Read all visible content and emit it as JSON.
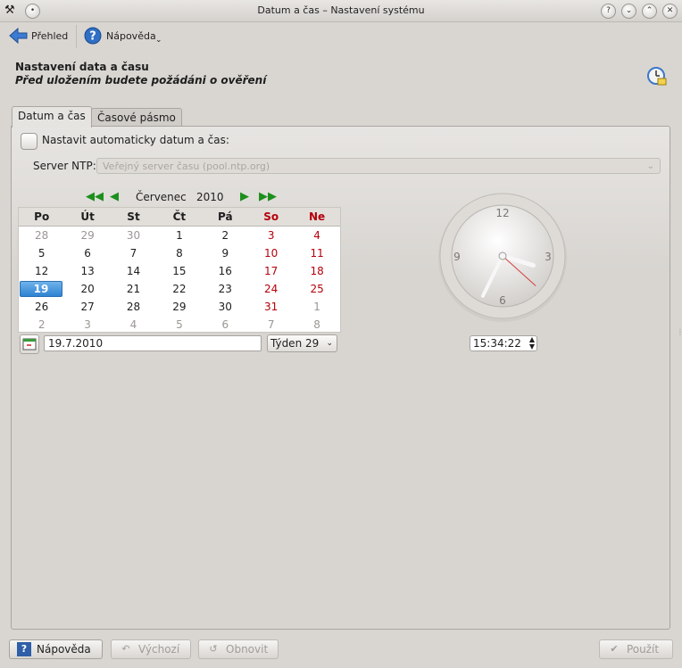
{
  "window": {
    "title": "Datum a čas – Nastavení systému"
  },
  "toolbar": {
    "back_label": "Přehled",
    "help_label": "Nápověda"
  },
  "header": {
    "title": "Nastavení data a času",
    "subtitle": "Před uložením budete požádáni o ověření"
  },
  "tabs": [
    {
      "label": "Datum a čas",
      "active": true
    },
    {
      "label": "Časové pásmo",
      "active": false
    }
  ],
  "auto": {
    "label": "Nastavit automaticky datum a čas:",
    "checked": false
  },
  "ntp": {
    "label": "Server NTP:",
    "value": "Veřejný server času (pool.ntp.org)"
  },
  "calendar": {
    "month": "Červenec",
    "year": "2010",
    "weekdays": [
      "Po",
      "Út",
      "St",
      "Čt",
      "Pá",
      "So",
      "Ne"
    ],
    "weeks": [
      [
        "28",
        "29",
        "30",
        "1",
        "2",
        "3",
        "4"
      ],
      [
        "5",
        "6",
        "7",
        "8",
        "9",
        "10",
        "11"
      ],
      [
        "12",
        "13",
        "14",
        "15",
        "16",
        "17",
        "18"
      ],
      [
        "19",
        "20",
        "21",
        "22",
        "23",
        "24",
        "25"
      ],
      [
        "26",
        "27",
        "28",
        "29",
        "30",
        "31",
        "1"
      ],
      [
        "2",
        "3",
        "4",
        "5",
        "6",
        "7",
        "8"
      ]
    ],
    "selected": "19",
    "weekend_color": "#b5000b",
    "selection_color": "#2f82d3"
  },
  "date_field": {
    "value": "19.7.2010"
  },
  "week_combo": {
    "value": "Týden 29"
  },
  "clock": {
    "numbers": [
      "12",
      "3",
      "6",
      "9"
    ],
    "time": "15:34:22"
  },
  "buttons": {
    "help": "Nápověda",
    "defaults": "Výchozí",
    "reset": "Obnovit",
    "apply": "Použít"
  }
}
